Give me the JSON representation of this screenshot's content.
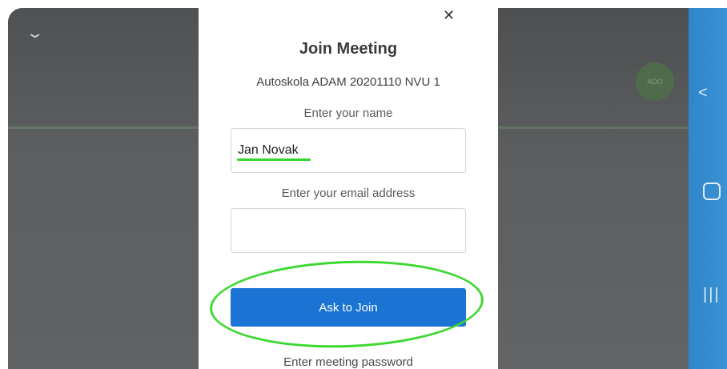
{
  "dialog": {
    "title": "Join Meeting",
    "meeting_name": "Autoskola ADAM 20201110 NVU 1",
    "name_label": "Enter your name",
    "name_value": "Jan Novak",
    "email_label": "Enter your email address",
    "email_value": "",
    "join_button": "Ask to Join",
    "password_label": "Enter meeting password"
  },
  "background": {
    "avatar_initials": "ADO"
  },
  "icons": {
    "collapse": "chevron-down-icon",
    "close": "close-icon",
    "nav_back": "back-icon",
    "nav_home": "home-icon",
    "nav_recents": "recents-icon"
  },
  "colors": {
    "join_button": "#1b73d3",
    "annotation": "#3ed832",
    "navbar": "#3a92d4"
  }
}
